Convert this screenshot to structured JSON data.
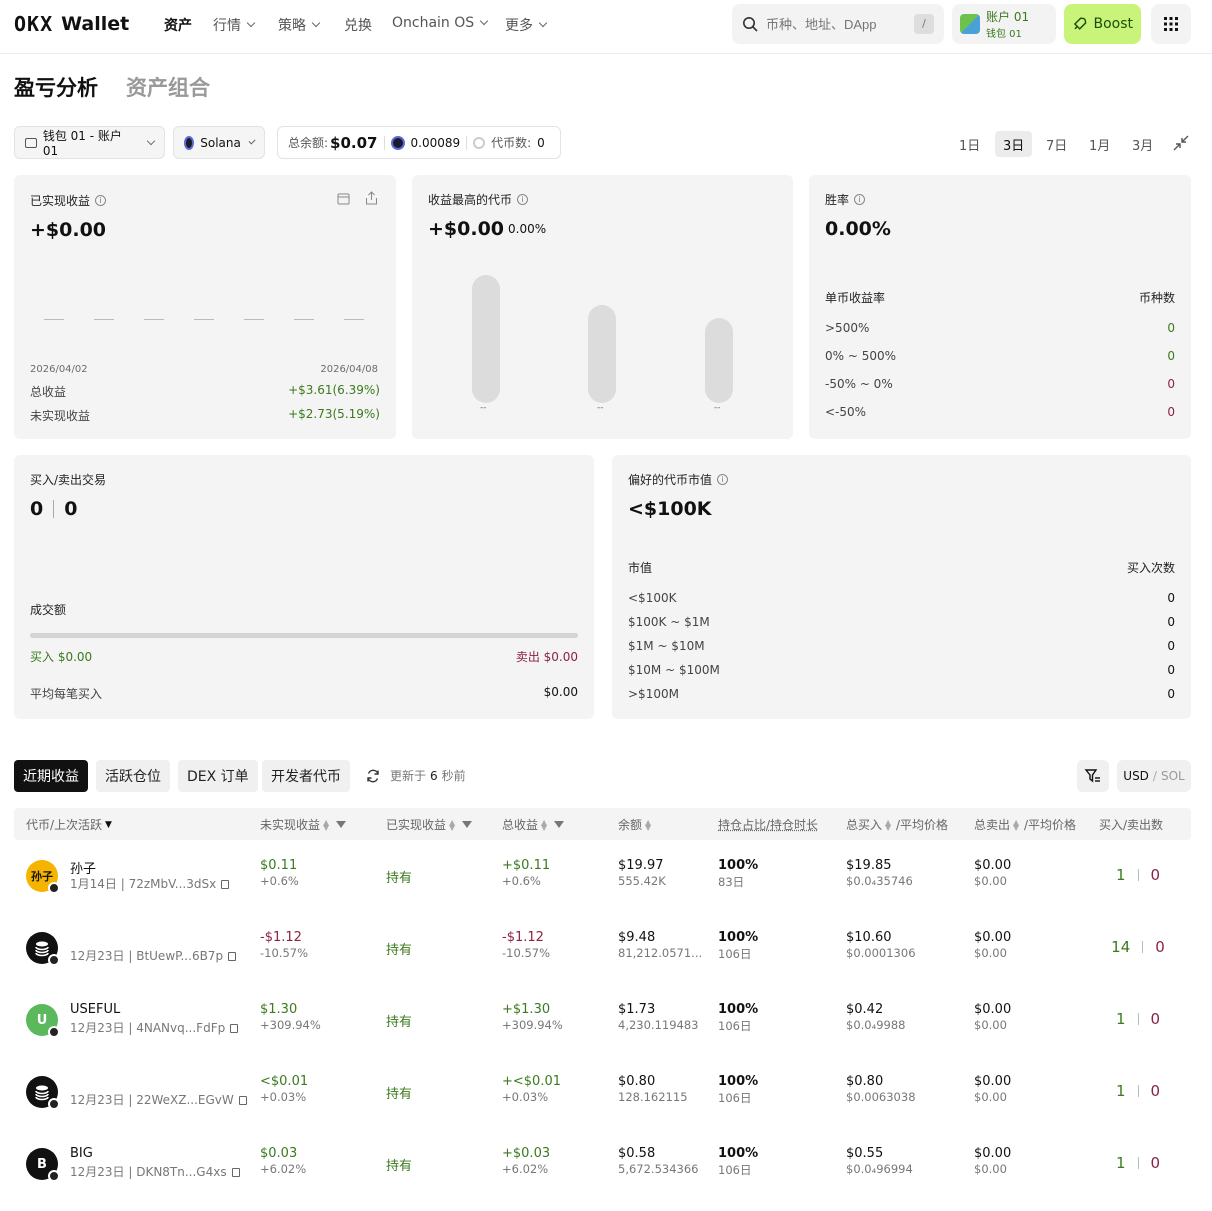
{
  "brand": {
    "logo_text": "OKX",
    "wallet_label": "Wallet"
  },
  "nav": {
    "items": [
      {
        "label": "资产",
        "has_dropdown": false,
        "active": true
      },
      {
        "label": "行情",
        "has_dropdown": true
      },
      {
        "label": "策略",
        "has_dropdown": true
      },
      {
        "label": "兑换",
        "has_dropdown": false
      },
      {
        "label": "Onchain OS",
        "has_dropdown": true
      },
      {
        "label": "更多",
        "has_dropdown": true
      }
    ]
  },
  "search": {
    "placeholder": "币种、地址、DApp",
    "shortcut": "/"
  },
  "account": {
    "name": "账户 01",
    "wallet": "钱包 01"
  },
  "boost_label": "Boost",
  "page_tabs": {
    "active": "盈亏分析",
    "inactive": "资产组合"
  },
  "filters": {
    "wallet_select": "钱包 01 - 账户 01",
    "chain_select": "Solana",
    "total_balance_label": "总余额:",
    "total_balance_value": "$0.07",
    "sol_amount": "0.00089",
    "token_count_label": "代币数:",
    "token_count_value": "0"
  },
  "time_ranges": [
    {
      "label": "1日",
      "active": false
    },
    {
      "label": "3日",
      "active": true
    },
    {
      "label": "7日",
      "active": false
    },
    {
      "label": "1月",
      "active": false
    },
    {
      "label": "3月",
      "active": false
    }
  ],
  "realized": {
    "title": "已实现收益",
    "value": "+$0.00",
    "date_start": "2026/04/02",
    "date_end": "2026/04/08",
    "total_label": "总收益",
    "total_value": "+$3.61(6.39%)",
    "unrealized_label": "未实现收益",
    "unrealized_value": "+$2.73(5.19%)"
  },
  "top_token": {
    "title": "收益最高的代币",
    "value": "+$0.00",
    "pct": "0.00%",
    "bar_labels": [
      "--",
      "--",
      "--"
    ]
  },
  "winrate": {
    "title": "胜率",
    "value": "0.00%",
    "col_left": "单币收益率",
    "col_right": "币种数",
    "rows": [
      {
        "label": ">500%",
        "value": "0",
        "color": "#3b7a1e"
      },
      {
        "label": "0% ~ 500%",
        "value": "0",
        "color": "#3b7a1e"
      },
      {
        "label": "-50% ~ 0%",
        "value": "0",
        "color": "#8b2340"
      },
      {
        "label": "<-50%",
        "value": "0",
        "color": "#8b2340"
      }
    ]
  },
  "trades": {
    "title": "买入/卖出交易",
    "buy_count": "0",
    "sell_count": "0",
    "volume_label": "成交额",
    "buy_label": "买入 $0.00",
    "sell_label": "卖出 $0.00",
    "avg_label": "平均每笔买入",
    "avg_value": "$0.00"
  },
  "mcap": {
    "title": "偏好的代币市值",
    "value": "<$100K",
    "col_left": "市值",
    "col_right": "买入次数",
    "rows": [
      {
        "label": "<$100K",
        "value": "0"
      },
      {
        "label": "$100K ~ $1M",
        "value": "0"
      },
      {
        "label": "$1M ~ $10M",
        "value": "0"
      },
      {
        "label": "$10M ~ $100M",
        "value": "0"
      },
      {
        "label": ">$100M",
        "value": "0"
      }
    ]
  },
  "bottom_tabs": [
    {
      "label": "近期收益",
      "active": true
    },
    {
      "label": "活跃仓位",
      "active": false
    },
    {
      "label": "DEX 订单",
      "active": false
    },
    {
      "label": "开发者代币",
      "active": false
    }
  ],
  "update": {
    "prefix": "更新于",
    "seconds": "6",
    "suffix": "秒前"
  },
  "currency": {
    "primary": "USD",
    "sep": "/",
    "secondary": "SOL"
  },
  "table": {
    "headers": {
      "token": "代币/上次活跃",
      "unrealized": "未实现收益",
      "realized": "已实现收益",
      "total": "总收益",
      "balance": "余额",
      "hold": "持仓占比/持仓时长",
      "buy": "总买入",
      "buy_avg": "/平均价格",
      "sell": "总卖出",
      "sell_avg": "/平均价格",
      "counts": "买入/卖出数"
    },
    "rows": [
      {
        "name": "孙子",
        "avatar_text": "孙子",
        "avatar_color": "#f4b400",
        "meta": "1月14日 | 72zMbV...3dSx",
        "unreal": "$0.11",
        "unreal_pct": "+0.6%",
        "unreal_color": "#3b7a1e",
        "realized": "持有",
        "total": "+$0.11",
        "total_pct": "+0.6%",
        "balance": "$19.97",
        "balance_sub": "555.42K",
        "hold": "100%",
        "hold_sub": "83日",
        "buy": "$19.85",
        "buy_sub": "$0.0₄35746",
        "sell": "$0.00",
        "sell_sub": "$0.00",
        "buys": "1",
        "sells": "0"
      },
      {
        "name": "",
        "avatar_text": "",
        "avatar_color": "#111111",
        "meta": "12月23日 | BtUewP...6B7p",
        "unreal": "-$1.12",
        "unreal_pct": "-10.57%",
        "unreal_color": "#8b2340",
        "realized": "持有",
        "total": "-$1.12",
        "total_pct": "-10.57%",
        "balance": "$9.48",
        "balance_sub": "81,212.0571...",
        "hold": "100%",
        "hold_sub": "106日",
        "buy": "$10.60",
        "buy_sub": "$0.0001306",
        "sell": "$0.00",
        "sell_sub": "$0.00",
        "buys": "14",
        "sells": "0"
      },
      {
        "name": "USEFUL",
        "avatar_text": "U",
        "avatar_color": "#5cb85c",
        "meta": "12月23日 | 4NANvq...FdFp",
        "unreal": "$1.30",
        "unreal_pct": "+309.94%",
        "unreal_color": "#3b7a1e",
        "realized": "持有",
        "total": "+$1.30",
        "total_pct": "+309.94%",
        "balance": "$1.73",
        "balance_sub": "4,230.119483",
        "hold": "100%",
        "hold_sub": "106日",
        "buy": "$0.42",
        "buy_sub": "$0.0₄9988",
        "sell": "$0.00",
        "sell_sub": "$0.00",
        "buys": "1",
        "sells": "0"
      },
      {
        "name": "",
        "avatar_text": "",
        "avatar_color": "#111111",
        "meta": "12月23日 | 22WeXZ...EGvW",
        "unreal": "<$0.01",
        "unreal_pct": "+0.03%",
        "unreal_color": "#3b7a1e",
        "realized": "持有",
        "total": "+<$0.01",
        "total_pct": "+0.03%",
        "balance": "$0.80",
        "balance_sub": "128.162115",
        "hold": "100%",
        "hold_sub": "106日",
        "buy": "$0.80",
        "buy_sub": "$0.0063038",
        "sell": "$0.00",
        "sell_sub": "$0.00",
        "buys": "1",
        "sells": "0"
      },
      {
        "name": "BIG",
        "avatar_text": "B",
        "avatar_color": "#111111",
        "meta": "12月23日 | DKN8Tn...G4xs",
        "unreal": "$0.03",
        "unreal_pct": "+6.02%",
        "unreal_color": "#3b7a1e",
        "realized": "持有",
        "total": "+$0.03",
        "total_pct": "+6.02%",
        "balance": "$0.58",
        "balance_sub": "5,672.534366",
        "hold": "100%",
        "hold_sub": "106日",
        "buy": "$0.55",
        "buy_sub": "$0.0₄96994",
        "sell": "$0.00",
        "sell_sub": "$0.00",
        "buys": "1",
        "sells": "0"
      }
    ]
  }
}
